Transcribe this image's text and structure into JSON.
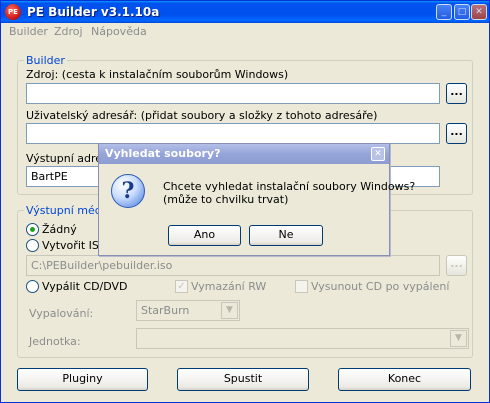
{
  "window": {
    "title": "PE Builder v3.1.10a",
    "app_icon_text": "PE",
    "controls": {
      "minimize": "_",
      "maximize": "□",
      "close": "✕"
    }
  },
  "menu": [
    "Builder",
    "Zdroj",
    "Nápověda"
  ],
  "builder_group": {
    "title": "Builder",
    "source_label": "Zdroj: (cesta k instalačním souborům Windows)",
    "source_value": "",
    "custom_label": "Uživatelský adresář: (přidat soubory a složky z tohoto adresáře)",
    "custom_value": "",
    "output_label": "Výstupní adresa",
    "output_value": "BartPE",
    "browse_label": "..."
  },
  "media_group": {
    "title": "Výstupní médium",
    "radio_none": "Žádný",
    "radio_iso": "Vytvořit ISO",
    "iso_path": "C:\\PEBuilder\\pebuilder.iso",
    "browse_label": "...",
    "radio_burn": "Vypálit CD/DVD",
    "erase_rw": "Vymazání RW",
    "eject_cd": "Vysunout CD po vypálení",
    "burn_label": "Vypalování:",
    "burn_engine": "StarBurn",
    "drive_label": "Jednotka:",
    "drive_value": ""
  },
  "buttons": {
    "plugins": "Pluginy",
    "start": "Spustit",
    "exit": "Konec"
  },
  "dialog": {
    "title": "Vyhledat soubory?",
    "close": "✕",
    "icon_glyph": "?",
    "message_line1": "Chcete vyhledat instalační soubory Windows?",
    "message_line2": "(může to chvilku trvat)",
    "yes": "Ano",
    "no": "Ne"
  },
  "colors": {
    "titlebar": "#0053ee",
    "dialog_title": "#95a4d9",
    "group_title": "#0046d5",
    "face": "#ece9d8"
  }
}
